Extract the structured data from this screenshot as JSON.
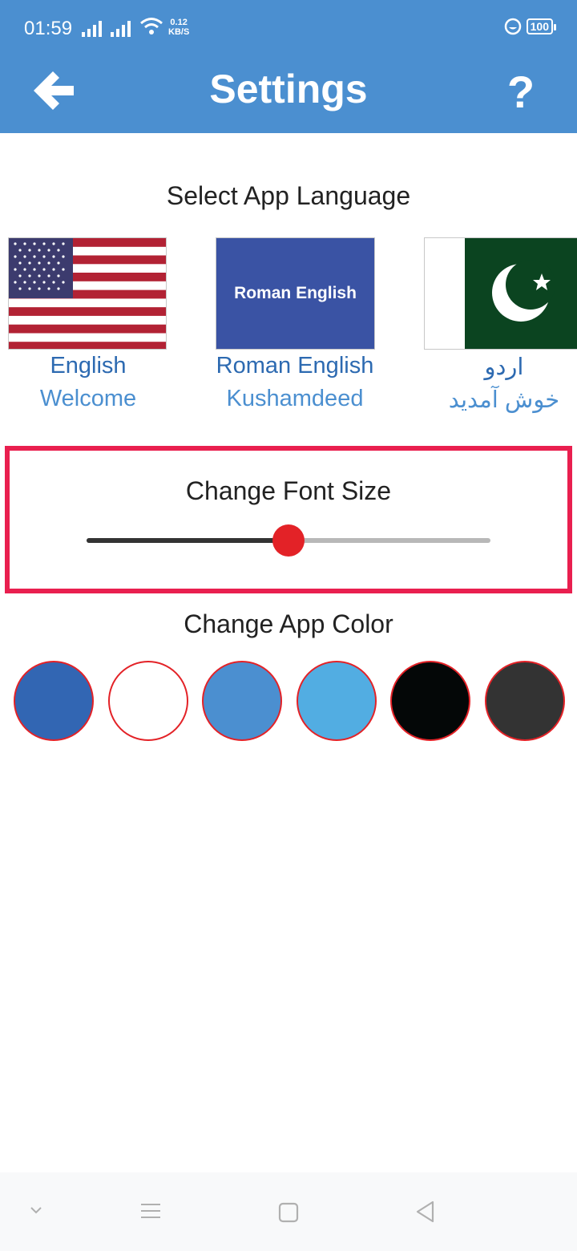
{
  "status_bar": {
    "time": "01:59",
    "net_speed_value": "0.12",
    "net_speed_unit": "KB/S",
    "battery": "100"
  },
  "header": {
    "title": "Settings",
    "back_icon": "arrow-left-icon",
    "help_label": "?"
  },
  "language_section": {
    "title": "Select App Language",
    "languages": [
      {
        "flag": "us-flag-icon",
        "name": "English",
        "greeting": "Welcome"
      },
      {
        "flag": "roman-english-flag",
        "flag_text": "Roman English",
        "name": "Roman English",
        "greeting": "Kushamdeed"
      },
      {
        "flag": "pakistan-flag-icon",
        "name": "اردو",
        "greeting": "خوش آمدید"
      }
    ]
  },
  "font_section": {
    "title": "Change Font Size",
    "slider_fraction": 0.5
  },
  "color_section": {
    "title": "Change App Color",
    "colors": [
      "#3266b3",
      "#ffffff",
      "#4b8fd0",
      "#52ade2",
      "#040707",
      "#333333"
    ]
  },
  "nav_bar": {
    "icons": [
      "chevron-down-icon",
      "menu-icon",
      "home-square-icon",
      "back-triangle-icon"
    ]
  },
  "accent": {
    "header": "#4b8fd0",
    "highlight": "#e91f4f",
    "thumb": "#e32227"
  }
}
